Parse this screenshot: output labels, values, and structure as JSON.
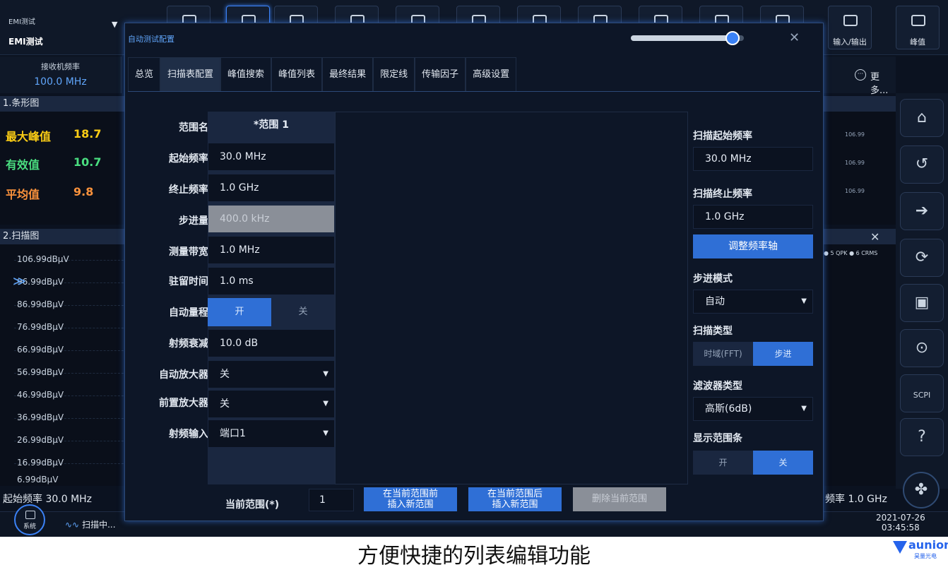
{
  "app": {
    "title": "EMI测试",
    "subtitle": "EMI测试"
  },
  "toolbar": {
    "io_label": "输入/输出",
    "peak_label": "峰值"
  },
  "receiver": {
    "title": "接收机频率",
    "value": "100.0 MHz"
  },
  "more": {
    "label": "更多..."
  },
  "bar_chart": {
    "title": "1.条形图",
    "rows": [
      {
        "label": "最大峰值",
        "value": "18.7",
        "color": "#facc15"
      },
      {
        "label": "有效值",
        "value": "10.7",
        "color": "#4ade80"
      },
      {
        "label": "平均值",
        "value": "9.8",
        "color": "#fb923c"
      }
    ],
    "right_ticks": [
      "106.99",
      "106.99",
      "106.99"
    ]
  },
  "scan_chart": {
    "title": "2.扫描图",
    "y_labels": [
      "106.99dBµV",
      "96.99dBµV",
      "86.99dBµV",
      "76.99dBµV",
      "66.99dBµV",
      "56.99dBµV",
      "46.99dBµV",
      "36.99dBµV",
      "26.99dBµV",
      "16.99dBµV",
      "6.99dBµV"
    ],
    "start_freq": "起始频率 30.0 MHz",
    "stop_freq": "频率 1.0 GHz",
    "legend": "● 5 QPK  ● 6 CRMS"
  },
  "status": {
    "system": "系统",
    "scanning": "扫描中...",
    "date": "2021-07-26",
    "time": "03:45:58"
  },
  "dialog": {
    "title": "自动测试配置",
    "slider_fraction": 0.9,
    "tabs": [
      "总览",
      "扫描表配置",
      "峰值搜索",
      "峰值列表",
      "最终结果",
      "限定线",
      "传输因子",
      "高级设置"
    ],
    "active_tab": 1,
    "fields": {
      "range_name": {
        "label": "范围名",
        "value": "*范围 1"
      },
      "start_freq": {
        "label": "起始频率",
        "value": "30.0 MHz"
      },
      "stop_freq": {
        "label": "终止频率",
        "value": "1.0 GHz"
      },
      "step": {
        "label": "步进量",
        "value": "400.0 kHz"
      },
      "meas_bw": {
        "label": "测量带宽",
        "value": "1.0 MHz"
      },
      "dwell": {
        "label": "驻留时间",
        "value": "1.0 ms"
      },
      "auto_range": {
        "label": "自动量程",
        "on": "开",
        "off": "关"
      },
      "rf_atten": {
        "label": "射频衰减",
        "value": "10.0 dB"
      },
      "auto_amp": {
        "label": "自动放大器",
        "value": "关"
      },
      "preamp": {
        "label": "前置放大器",
        "value": "关"
      },
      "rf_input": {
        "label": "射频输入",
        "value": "端口1"
      }
    },
    "right": {
      "scan_start_label": "扫描起始频率",
      "scan_start_value": "30.0 MHz",
      "scan_stop_label": "扫描终止频率",
      "scan_stop_value": "1.0 GHz",
      "adjust_axis": "调整频率轴",
      "step_mode_label": "步进模式",
      "step_mode_value": "自动",
      "scan_type_label": "扫描类型",
      "scan_type_fft": "时域(FFT)",
      "scan_type_step": "步进",
      "filter_label": "滤波器类型",
      "filter_value": "高斯(6dB)",
      "show_range_label": "显示范围条",
      "show_on": "开",
      "show_off": "关"
    },
    "footer": {
      "current_label": "当前范围(*)",
      "current_value": "1",
      "insert_before_1": "在当前范围前",
      "insert_before_2": "插入新范围",
      "insert_after_1": "在当前范围后",
      "insert_after_2": "插入新范围",
      "delete": "删除当前范围"
    }
  },
  "caption": "方便快捷的列表编辑功能",
  "logo": {
    "word": "aunion",
    "sub": "昊量光电"
  }
}
